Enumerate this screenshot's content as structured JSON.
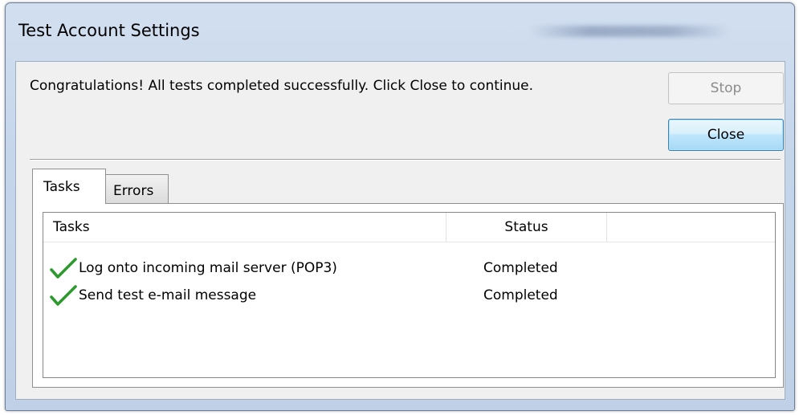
{
  "window": {
    "title": "Test Account Settings"
  },
  "message": "Congratulations! All tests completed successfully. Click Close to continue.",
  "buttons": {
    "stop_label": "Stop",
    "close_label": "Close"
  },
  "tabs": [
    {
      "label": "Tasks",
      "selected": true
    },
    {
      "label": "Errors",
      "selected": false
    }
  ],
  "table": {
    "columns": [
      "Tasks",
      "Status"
    ],
    "rows": [
      {
        "icon": "check-icon",
        "task": "Log onto incoming mail server (POP3)",
        "status": "Completed"
      },
      {
        "icon": "check-icon",
        "task": "Send test e-mail message",
        "status": "Completed"
      }
    ]
  },
  "colors": {
    "check_green": "#2e9a2e",
    "close_button_border": "#3c7fb1",
    "frame_blue": "#c5d5ea"
  }
}
